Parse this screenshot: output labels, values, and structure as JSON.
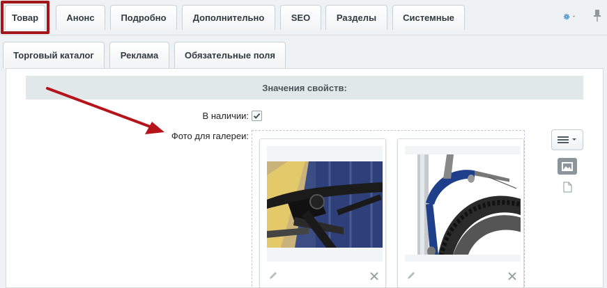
{
  "tabs": [
    "Товар",
    "Анонс",
    "Подробно",
    "Дополнительно",
    "SEO",
    "Разделы",
    "Системные"
  ],
  "subtabs": [
    "Торговый каталог",
    "Реклама",
    "Обязательные поля"
  ],
  "section": {
    "title": "Значения свойств:"
  },
  "props": {
    "in_stock_label": "В наличии:",
    "in_stock_checked": true,
    "gallery_label": "Фото для галереи:"
  },
  "colors": {
    "highlight": "#a3161a",
    "accent": "#2e7fc1",
    "arrow": "#b5141b"
  },
  "icons": [
    "gear-icon",
    "chevron-down-icon",
    "pin-icon",
    "menu-icon",
    "image-view-icon",
    "file-view-icon",
    "pencil-icon",
    "close-icon",
    "checkmark-icon"
  ]
}
